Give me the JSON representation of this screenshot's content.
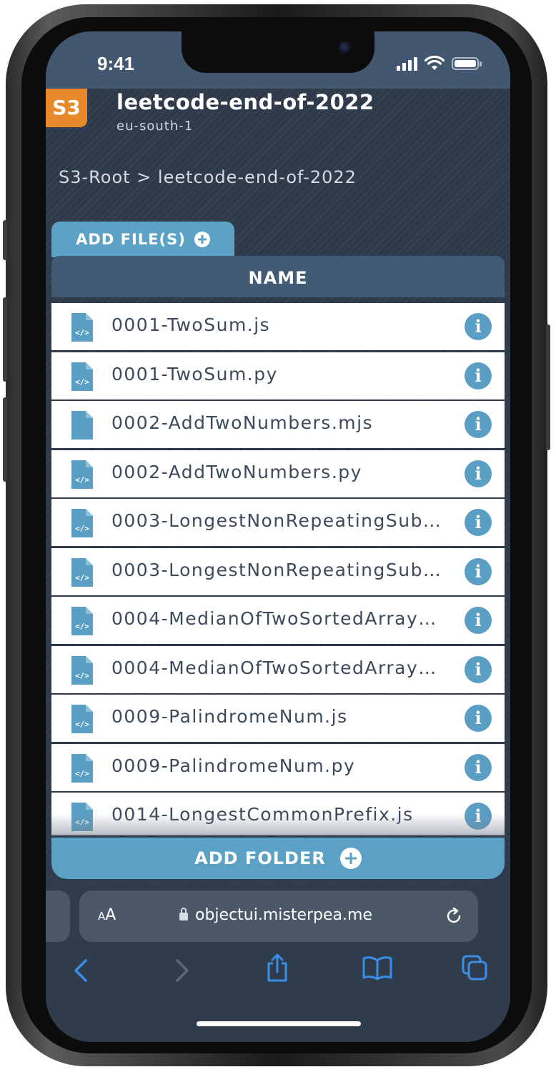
{
  "status_bar": {
    "time": "9:41"
  },
  "bucket": {
    "badge": "S3",
    "name": "leetcode-end-of-2022",
    "region": "eu-south-1"
  },
  "breadcrumb": "S3-Root > leetcode-end-of-2022",
  "actions": {
    "add_files": "ADD FILE(S)",
    "add_folder": "ADD FOLDER"
  },
  "table": {
    "header": "NAME",
    "files": [
      {
        "name": "0001-TwoSum.js",
        "icon": "code-file-icon"
      },
      {
        "name": "0001-TwoSum.py",
        "icon": "code-file-icon"
      },
      {
        "name": "0002-AddTwoNumbers.mjs",
        "icon": "file-icon"
      },
      {
        "name": "0002-AddTwoNumbers.py",
        "icon": "code-file-icon"
      },
      {
        "name": "0003-LongestNonRepeatingSub…",
        "icon": "code-file-icon"
      },
      {
        "name": "0003-LongestNonRepeatingSub…",
        "icon": "code-file-icon"
      },
      {
        "name": "0004-MedianOfTwoSortedArray…",
        "icon": "code-file-icon"
      },
      {
        "name": "0004-MedianOfTwoSortedArray…",
        "icon": "code-file-icon"
      },
      {
        "name": "0009-PalindromeNum.js",
        "icon": "code-file-icon"
      },
      {
        "name": "0009-PalindromeNum.py",
        "icon": "code-file-icon"
      },
      {
        "name": "0014-LongestCommonPrefix.js",
        "icon": "code-file-icon"
      }
    ],
    "info_glyph": "i"
  },
  "browser": {
    "text_size_label": "AA",
    "url": "objectui.misterpea.me"
  },
  "colors": {
    "accent": "#5ba2c6",
    "badge": "#e8892b",
    "header": "#425a74",
    "background": "#2e3a4a"
  }
}
